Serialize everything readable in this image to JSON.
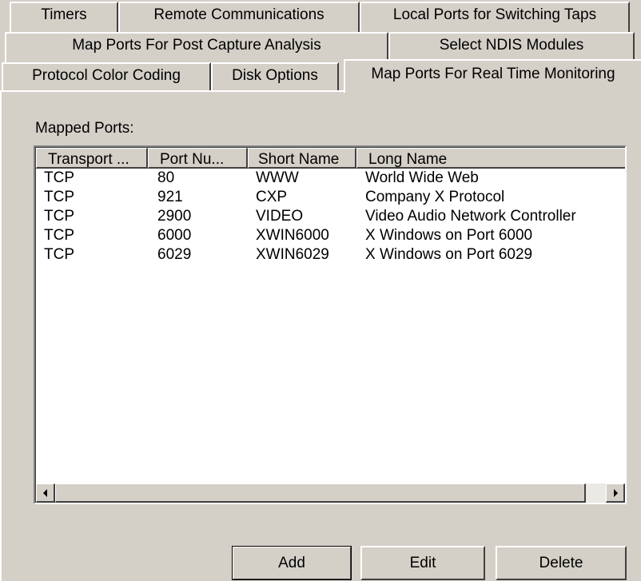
{
  "tabs": {
    "row1": [
      "Timers",
      "Remote Communications",
      "Local Ports for Switching Taps"
    ],
    "row2": [
      "Map Ports For Post Capture Analysis",
      "Select NDIS Modules"
    ],
    "row3": [
      "Protocol Color Coding",
      "Disk Options",
      "Map Ports For Real Time Monitoring"
    ],
    "selected": "Map Ports For Real Time Monitoring"
  },
  "panel": {
    "label": "Mapped Ports:"
  },
  "list": {
    "columns": [
      "Transport ...",
      "Port Nu...",
      "Short Name",
      "Long Name"
    ],
    "rows": [
      [
        "TCP",
        "80",
        "WWW",
        "World Wide Web"
      ],
      [
        "TCP",
        "921",
        "CXP",
        "Company X Protocol"
      ],
      [
        "TCP",
        "2900",
        "VIDEO",
        "Video Audio Network Controller"
      ],
      [
        "TCP",
        "6000",
        "XWIN6000",
        "X Windows on Port 6000"
      ],
      [
        "TCP",
        "6029",
        "XWIN6029",
        "X Windows on Port 6029"
      ]
    ]
  },
  "scrollbar": {
    "left_icon": "scroll-left-arrow-icon",
    "right_icon": "scroll-right-arrow-icon"
  },
  "buttons": {
    "add": "Add",
    "edit": "Edit",
    "delete": "Delete"
  },
  "colors": {
    "face": "#d4d0c8",
    "highlight": "#ffffff",
    "shadow": "#404040",
    "window": "#ffffff"
  }
}
